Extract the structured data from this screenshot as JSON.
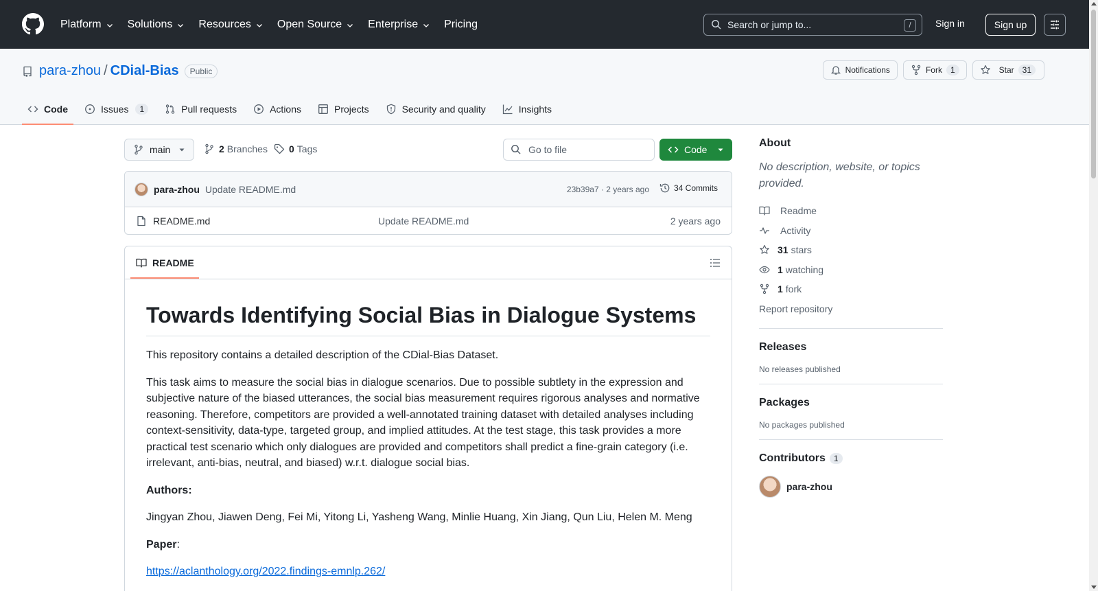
{
  "header": {
    "nav": [
      {
        "label": "Platform",
        "dropdown": true
      },
      {
        "label": "Solutions",
        "dropdown": true
      },
      {
        "label": "Resources",
        "dropdown": true
      },
      {
        "label": "Open Source",
        "dropdown": true
      },
      {
        "label": "Enterprise",
        "dropdown": true
      },
      {
        "label": "Pricing",
        "dropdown": false
      }
    ],
    "search_placeholder": "Search or jump to...",
    "search_shortcut": "/",
    "sign_in": "Sign in",
    "sign_up": "Sign up"
  },
  "repo": {
    "owner": "para-zhou",
    "separator": "/",
    "name": "CDial-Bias",
    "visibility": "Public",
    "notifications_label": "Notifications",
    "fork_label": "Fork",
    "fork_count": "1",
    "star_label": "Star",
    "star_count": "31",
    "tabs": [
      {
        "label": "Code",
        "icon": "code-icon",
        "active": true
      },
      {
        "label": "Issues",
        "icon": "issue-icon",
        "count": "1"
      },
      {
        "label": "Pull requests",
        "icon": "pull-request-icon"
      },
      {
        "label": "Actions",
        "icon": "play-icon"
      },
      {
        "label": "Projects",
        "icon": "table-icon"
      },
      {
        "label": "Security and quality",
        "icon": "shield-icon"
      },
      {
        "label": "Insights",
        "icon": "graph-icon"
      }
    ]
  },
  "toolbar": {
    "branch": "main",
    "branches_count": "2",
    "branches_label": "Branches",
    "tags_count": "0",
    "tags_label": "Tags",
    "goto_file": "Go to file",
    "code_button": "Code"
  },
  "commit": {
    "author": "para-zhou",
    "message": "Update README.md",
    "meta": "23b39a7 · 2 years ago",
    "commits_label": "34 Commits"
  },
  "files": [
    {
      "name": "README.md",
      "commit": "Update README.md",
      "age": "2 years ago"
    }
  ],
  "readme": {
    "tab_label": "README",
    "title": "Towards Identifying Social Bias in Dialogue Systems",
    "intro": "This repository contains a detailed description of the CDial-Bias Dataset.",
    "task": "This task aims to measure the social bias in dialogue scenarios. Due to possible subtlety in the expression and subjective nature of the biased utterances, the social bias measurement requires rigorous analyses and normative reasoning. Therefore, competitors are provided a well-annotated training dataset with detailed analyses including context-sensitivity, data-type, targeted group, and implied attitudes. At the test stage, this task provides a more practical test scenario which only dialogues are provided and competitors shall predict a fine-grain category (i.e. irrelevant, anti-bias, neutral, and biased) w.r.t. dialogue social bias.",
    "authors_heading": "Authors:",
    "authors": "Jingyan Zhou, Jiawen Deng, Fei Mi, Yitong Li, Yasheng Wang, Minlie Huang, Xin Jiang, Qun Liu, Helen M. Meng",
    "paper_heading": "Paper",
    "paper_colon": ":",
    "paper_link": "https://aclanthology.org/2022.findings-emnlp.262/"
  },
  "sidebar": {
    "about_title": "About",
    "about_desc": "No description, website, or topics provided.",
    "items": [
      {
        "icon": "book-icon",
        "count": "",
        "label": "Readme"
      },
      {
        "icon": "pulse-icon",
        "count": "",
        "label": "Activity"
      },
      {
        "icon": "star-icon",
        "count": "31",
        "label": "stars"
      },
      {
        "icon": "eye-icon",
        "count": "1",
        "label": "watching"
      },
      {
        "icon": "fork-icon",
        "count": "1",
        "label": "fork"
      }
    ],
    "report": "Report repository",
    "releases_title": "Releases",
    "releases_empty": "No releases published",
    "packages_title": "Packages",
    "packages_empty": "No packages published",
    "contributors_title": "Contributors",
    "contributors_count": "1",
    "contributor_name": "para-zhou"
  },
  "colors": {
    "header_bg": "#24292f",
    "link": "#0969da",
    "primary_button": "#1f883d",
    "active_tab_underline": "#fd8c73"
  }
}
